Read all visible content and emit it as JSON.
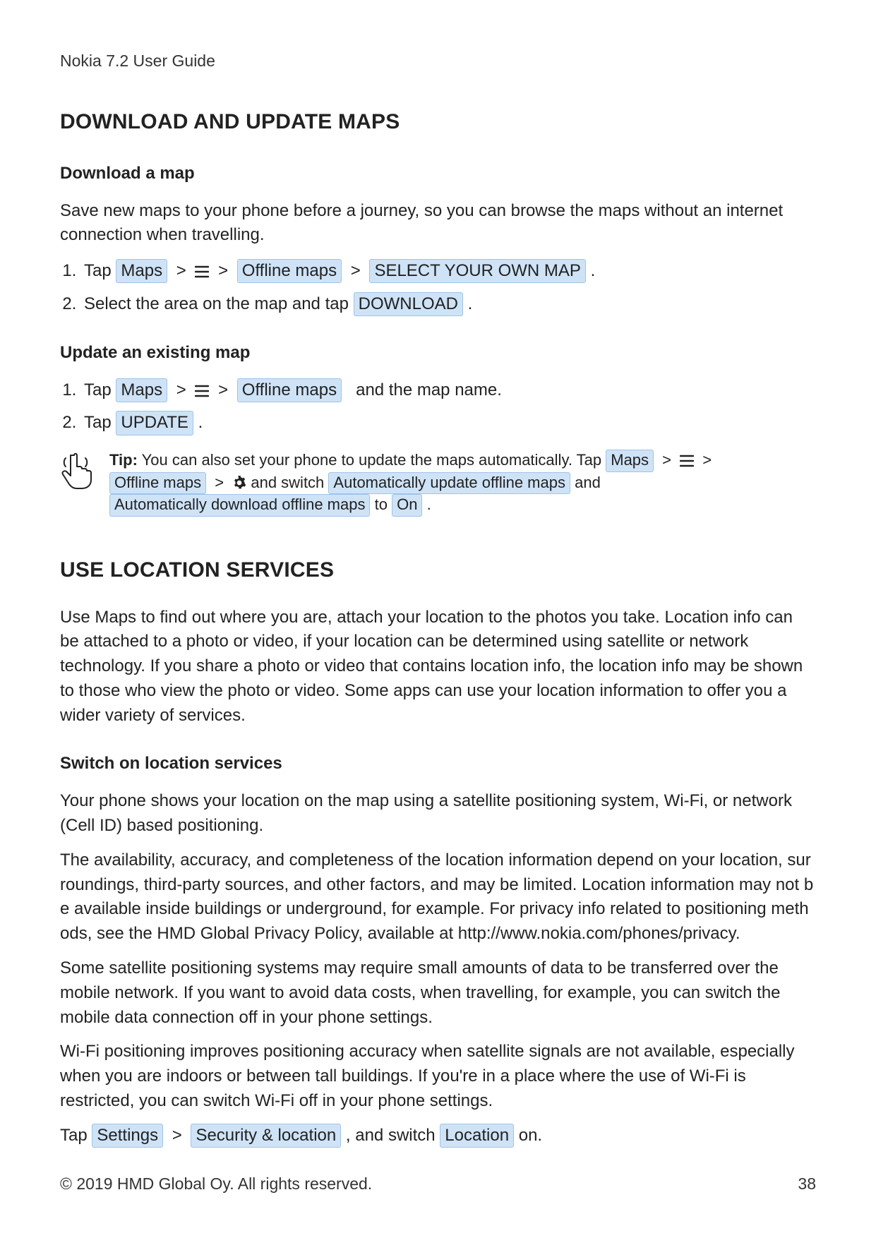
{
  "header": "Nokia 7.2 User Guide",
  "sec1": {
    "title": "DOWNLOAD AND UPDATE MAPS",
    "sub1": {
      "title": "Download a map",
      "intro": "Save new maps to your phone before a journey, so you can browse the maps without an internet connection when travelling.",
      "step1": {
        "tap": "Tap",
        "maps": "Maps",
        "offline": "Offline maps",
        "select": "SELECT YOUR OWN MAP",
        "period": "."
      },
      "step2": {
        "text_a": "Select the area on the map and tap",
        "download": "DOWNLOAD",
        "period": "."
      }
    },
    "sub2": {
      "title": "Update an existing map",
      "step1": {
        "tap": "Tap",
        "maps": "Maps",
        "offline": "Offline maps",
        "tail": "and the map name."
      },
      "step2": {
        "tap": "Tap",
        "update": "UPDATE",
        "period": "."
      }
    },
    "tip": {
      "label": "Tip:",
      "a": "You can also set your phone to update the maps automatically. Tap",
      "maps": "Maps",
      "offline": "Offline maps",
      "and_switch": "and switch",
      "opt1": "Automatically update offline maps",
      "and": "and",
      "opt2": "Automatically download offline maps",
      "to": "to",
      "on": "On",
      "period": "."
    }
  },
  "sec2": {
    "title": "USE LOCATION SERVICES",
    "intro": "Use Maps to find out where you are, attach your location to the photos you take. Location info can be attached to a photo or video, if your location can be determined using satellite or network technology. If you share a photo or video that contains location info, the location info may be shown to those who view the photo or video. Some apps can use your location information to offer you a wider variety of services.",
    "sub1": {
      "title": "Switch on location services",
      "p1": "Your phone shows your location on the map using a satellite positioning system, Wi-Fi, or network (Cell ID) based positioning.",
      "p2": "The availability, accuracy, and completeness of the location information depend on your location, surroundings, third-party sources, and other factors, and may be limited. Location information may not be available inside buildings or underground, for example. For privacy info related to positioning methods, see the HMD Global Privacy Policy, available at http://www.nokia.com/phones/privacy.",
      "p3": "Some satellite positioning systems may require small amounts of data to be transferred over the mobile network. If you want to avoid data costs, when travelling, for example, you can switch the mobile data connection off in your phone settings.",
      "p4": "Wi-Fi positioning improves positioning accuracy when satellite signals are not available, especially when you are indoors or between tall buildings. If you're in a place where the use of Wi-Fi is restricted, you can switch Wi-Fi off in your phone settings.",
      "tap": {
        "tap": "Tap",
        "settings": "Settings",
        "security": "Security & location",
        "tail": ", and switch",
        "location": "Location",
        "on": "on."
      }
    }
  },
  "footer": {
    "copyright": "© 2019 HMD Global Oy. All rights reserved.",
    "page": "38"
  }
}
